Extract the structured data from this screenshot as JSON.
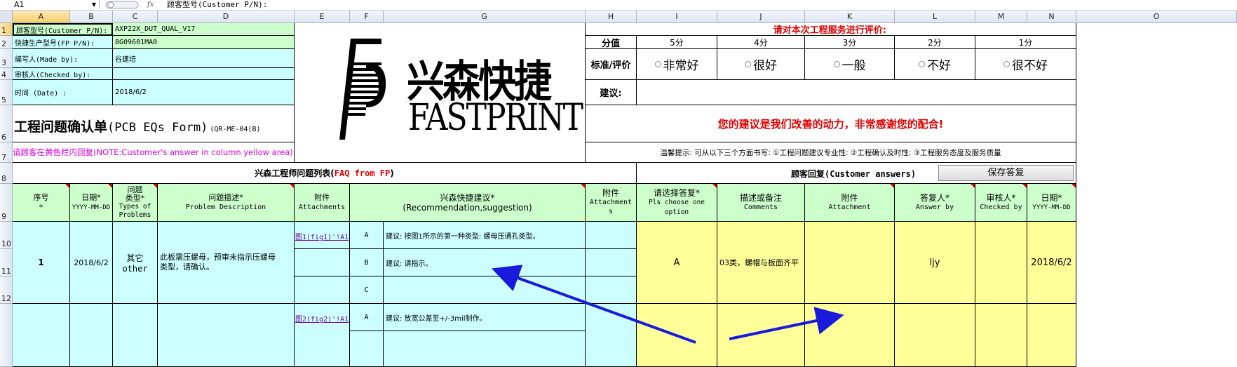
{
  "formula_bar": {
    "cell_ref": "A1",
    "fx": "fx",
    "formula": "顾客型号(Customer P/N):"
  },
  "columns": [
    "A",
    "B",
    "C",
    "D",
    "E",
    "F",
    "G",
    "H",
    "I",
    "J",
    "K",
    "L",
    "M",
    "N",
    "O"
  ],
  "rows": [
    "1",
    "2",
    "3",
    "4",
    "5",
    "6",
    "7",
    "8",
    "9",
    "10",
    "11",
    "12"
  ],
  "header_info": {
    "customer_pn_label": "顾客型号(Customer P/N):",
    "customer_pn_value": "AXP22X_DUT_QUAL_V17",
    "fp_pn_label": "快捷生产型号(FP P/N):",
    "fp_pn_value": "8G09601MA0",
    "made_by_label": "编写人(Made by):",
    "made_by_value": "谷建培",
    "checked_by_label": "审核人(Checked by):",
    "checked_by_value": "",
    "date_label": "时间 (Date) :",
    "date_value": "2018/6/2",
    "form_title": "工程问题确认单",
    "form_title_en": "(PCB EQs Form)",
    "form_code": "(QR-ME-04(B)",
    "note": "请顾客在黄色栏内回复(NOTE:Customer's answer in column yellow area)"
  },
  "logo": {
    "cn": "兴森快捷",
    "en": "FASTPRINT"
  },
  "rating": {
    "title": "请对本次工程服务进行评价:",
    "score_label": "分值",
    "scores": [
      "5分",
      "4分",
      "3分",
      "2分",
      "1分"
    ],
    "standard_label": "标准/评价",
    "options": [
      "非常好",
      "很好",
      "一般",
      "不好",
      "很不好"
    ],
    "suggestion_label": "建议:",
    "thanks": "您的建议是我们改善的动力，非常感谢您的配合!",
    "tip": "温馨提示: 可从以下三个方面书写: ①工程问题建议专业性: ②工程确认及时性: ③工程服务态度及服务质量"
  },
  "faq_section": {
    "title_cn": "兴森工程师问题列表(",
    "title_en": "FAQ from FP",
    "title_close": ")"
  },
  "answer_section": {
    "title": "顾客回复(Customer answers)",
    "save_button": "保存答复"
  },
  "table_headers": {
    "seq": [
      "序号",
      "*"
    ],
    "date": [
      "日期*",
      "YYYY-MM-DD"
    ],
    "type": [
      "问题",
      "类型*",
      "Types of",
      "Problems"
    ],
    "desc": [
      "问题描述*",
      "Problem Description"
    ],
    "attach": [
      "附件",
      "Attachments"
    ],
    "recommend": [
      "兴森快捷建议*",
      "(Recommendation,suggestion)"
    ],
    "attach2": [
      "附件",
      "Attachment",
      "s"
    ],
    "choose": [
      "请选择答复*",
      "Pls choose one option"
    ],
    "comments": [
      "描述或备注",
      "Comments"
    ],
    "attach3": [
      "附件",
      "Attachment"
    ],
    "answer_by": [
      "答复人*",
      "Answer by"
    ],
    "checked_by": [
      "审核人*",
      "Checked by"
    ],
    "date2": [
      "日期*",
      "YYYY-MM-DD"
    ]
  },
  "rows_data": [
    {
      "seq": "1",
      "date": "2018/6/2",
      "type_cn": "其它",
      "type_en": "other",
      "desc": "此板需压螺母，预审未指示压螺母类型，请确认。",
      "attachment": "图1(fig1)'!A1",
      "options": [
        {
          "letter": "A",
          "text": "建议: 按图1所示的第一种类型: 螺母压通孔类型。"
        },
        {
          "letter": "B",
          "text": "建议: 请指示。"
        },
        {
          "letter": "C",
          "text": ""
        }
      ],
      "choice": "A",
      "comment": "03类，螺帽与板面齐平",
      "answer_by": "ljy",
      "answer_date": "2018/6/2"
    },
    {
      "attachment": "图2(fig2)'!A1",
      "options": [
        {
          "letter": "A",
          "text": "建议: 放宽公差至+/-3mil制作。"
        }
      ]
    }
  ],
  "colors": {
    "green": "#ccffcc",
    "cyan": "#ccffff",
    "yellow": "#ffff99",
    "red": "#e00000",
    "arrow": "#1a1adc"
  }
}
